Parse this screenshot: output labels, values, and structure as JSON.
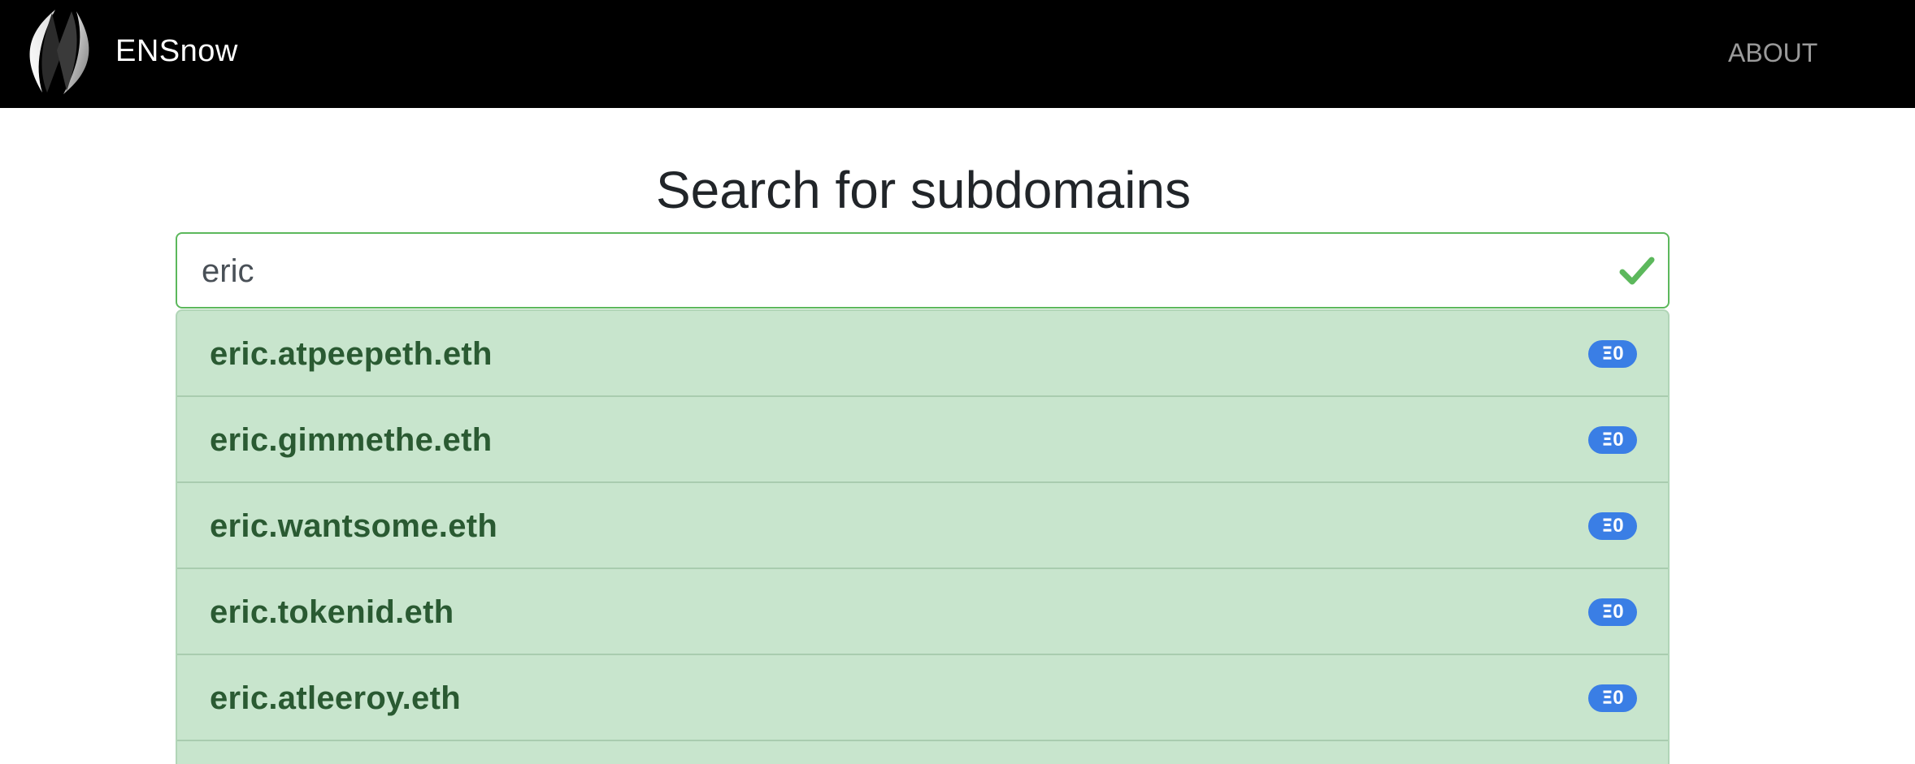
{
  "navbar": {
    "brand": "ENSnow",
    "about_label": "ABOUT"
  },
  "main": {
    "title": "Search for subdomains",
    "search": {
      "value": "eric",
      "status_icon": "check-icon",
      "status_color": "#5cb85c"
    },
    "results": [
      {
        "name": "eric.atpeepeth.eth",
        "price": "0",
        "currency_symbol": "Ξ"
      },
      {
        "name": "eric.gimmethe.eth",
        "price": "0",
        "currency_symbol": "Ξ"
      },
      {
        "name": "eric.wantsome.eth",
        "price": "0",
        "currency_symbol": "Ξ"
      },
      {
        "name": "eric.tokenid.eth",
        "price": "0",
        "currency_symbol": "Ξ"
      },
      {
        "name": "eric.atleeroy.eth",
        "price": "0",
        "currency_symbol": "Ξ"
      }
    ]
  },
  "colors": {
    "navbar_bg": "#000000",
    "result_bg": "#c8e5cd",
    "result_text": "#2a5a32",
    "badge_bg": "#3a7ee5"
  }
}
